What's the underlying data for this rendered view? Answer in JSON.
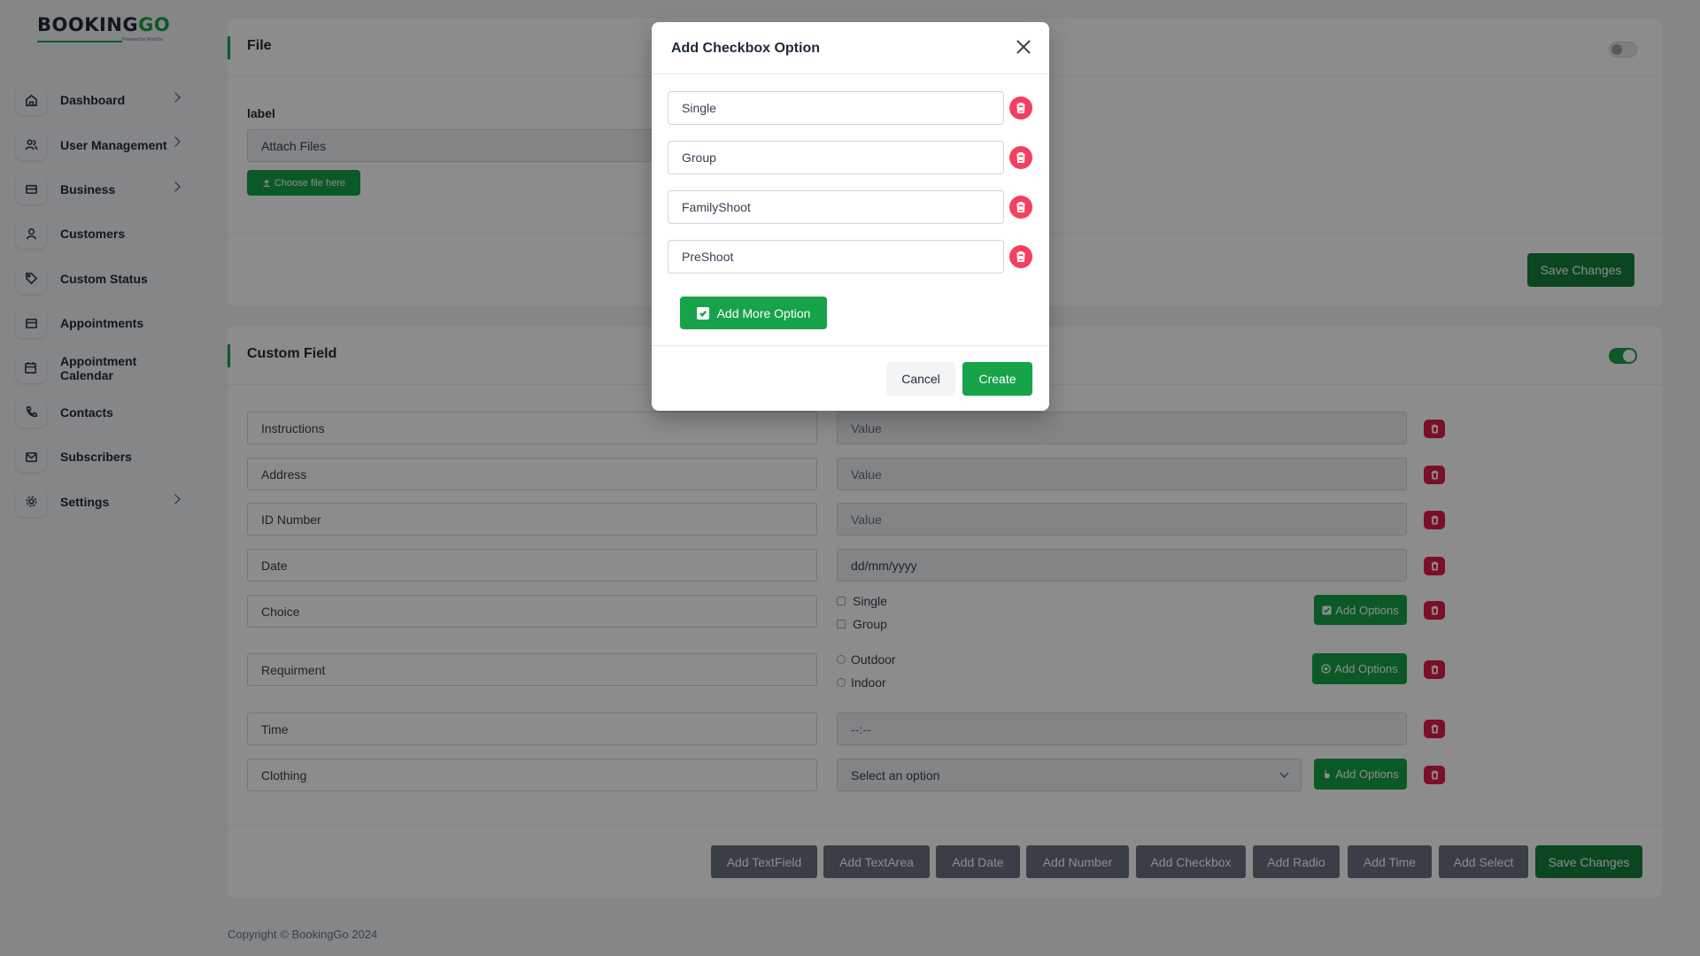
{
  "brand": {
    "name_main": "BOOKING",
    "name_accent": "GO",
    "tagline": "Powered by WorkDo"
  },
  "sidebar": {
    "items": [
      {
        "label": "Dashboard",
        "icon": "home-icon",
        "has_children": true
      },
      {
        "label": "User Management",
        "icon": "users-icon",
        "has_children": true
      },
      {
        "label": "Business",
        "icon": "briefcase-icon",
        "has_children": true
      },
      {
        "label": "Customers",
        "icon": "user-icon",
        "has_children": false
      },
      {
        "label": "Custom Status",
        "icon": "tag-icon",
        "has_children": false
      },
      {
        "label": "Appointments",
        "icon": "card-icon",
        "has_children": false
      },
      {
        "label": "Appointment Calendar",
        "icon": "calendar-icon",
        "has_children": false
      },
      {
        "label": "Contacts",
        "icon": "phone-icon",
        "has_children": false
      },
      {
        "label": "Subscribers",
        "icon": "mail-icon",
        "has_children": false
      },
      {
        "label": "Settings",
        "icon": "gear-icon",
        "has_children": true
      }
    ]
  },
  "file_card": {
    "title": "File",
    "toggle_on": false,
    "field_label": "label",
    "field_value": "Attach Files",
    "choose_button": "Choose file here",
    "save_button": "Save Changes"
  },
  "custom_field_card": {
    "title": "Custom Field",
    "toggle_on": true,
    "rows": {
      "instructions": {
        "name": "Instructions",
        "value_placeholder": "Value"
      },
      "address": {
        "name": "Address",
        "value_placeholder": "Value"
      },
      "id_number": {
        "name": "ID Number",
        "value_placeholder": "Value"
      },
      "date": {
        "name": "Date",
        "value_placeholder": "dd/mm/yyyy"
      },
      "choice": {
        "name": "Choice",
        "options": [
          "Single",
          "Group"
        ],
        "add_button": "Add Options"
      },
      "requirement": {
        "name": "Requirment",
        "options": [
          "Outdoor",
          "Indoor"
        ],
        "add_button": "Add Options"
      },
      "time": {
        "name": "Time",
        "value_placeholder": "--:--"
      },
      "clothing": {
        "name": "Clothing",
        "select_value": "Select an option",
        "add_button": "Add Options"
      }
    },
    "add_buttons": {
      "textfield": "Add TextField",
      "textarea": "Add TextArea",
      "date": "Add Date",
      "number": "Add Number",
      "checkbox": "Add Checkbox",
      "radio": "Add Radio",
      "time": "Add Time",
      "select": "Add Select"
    },
    "save_button": "Save Changes"
  },
  "footer": {
    "copyright": "Copyright © BookingGo 2024"
  },
  "modal": {
    "title": "Add Checkbox Option",
    "options": [
      "Single",
      "Group",
      "FamilyShoot",
      "PreShoot"
    ],
    "add_more_button": "Add More Option",
    "cancel_button": "Cancel",
    "create_button": "Create"
  },
  "colors": {
    "primary_green": "#16a34a",
    "delete_red": "#e11d48",
    "dark_button": "#6b7280"
  }
}
